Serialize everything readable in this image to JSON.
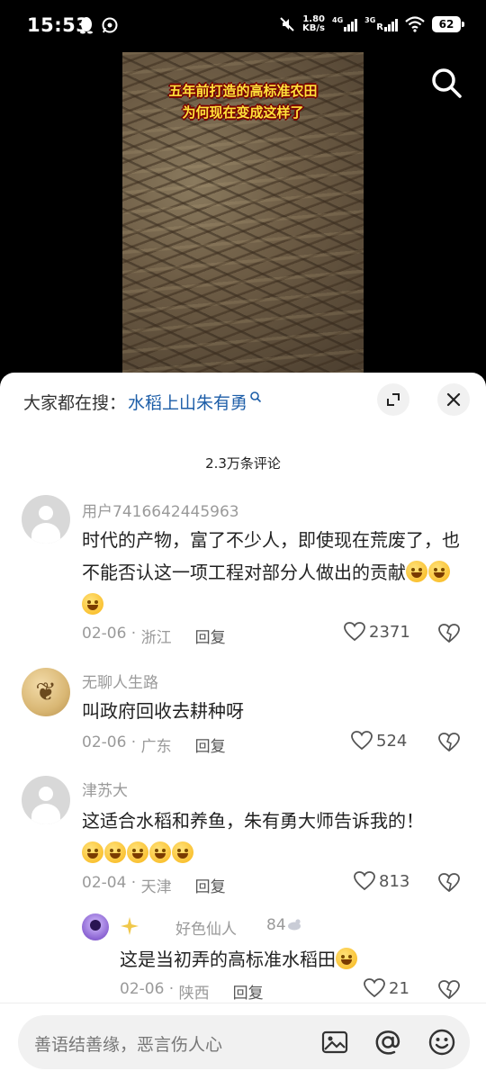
{
  "status_bar": {
    "time": "15:53",
    "net_speed_value": "1.80",
    "net_speed_unit": "KB/s",
    "sim1_label": "4G",
    "sim2_label": "3G",
    "sim2_roaming": "R",
    "battery": "62"
  },
  "video": {
    "caption_line1": "五年前打造的高标准农田",
    "caption_line2": "为何现在变成这样了"
  },
  "sheet": {
    "search_prefix": "大家都在搜：",
    "search_term": "水稻上山朱有勇",
    "comment_count": "2.3万条评论"
  },
  "comments": [
    {
      "user": "用户7416642445963",
      "text": "时代的产物，富了不少人，即使现在荒废了，也不能否认这一项工程对部分人做出的贡献",
      "emoji_count": 3,
      "date": "02-06",
      "location": "浙江",
      "reply_label": "回复",
      "likes": "2371"
    },
    {
      "user": "无聊人生路",
      "text": "叫政府回收去耕种呀",
      "date": "02-06",
      "location": "广东",
      "reply_label": "回复",
      "likes": "524"
    },
    {
      "user": "津苏大",
      "text": "这适合水稻和养鱼，朱有勇大师告诉我的！",
      "emoji_count": 5,
      "date": "02-04",
      "location": "天津",
      "reply_label": "回复",
      "likes": "813"
    }
  ],
  "reply": {
    "user": "好色仙人",
    "level": "84",
    "text": "这是当初弄的高标准水稻田",
    "date": "02-06",
    "location": "陕西",
    "reply_label": "回复",
    "likes": "21"
  },
  "input": {
    "placeholder": "善语结善缘，恶言伤人心"
  },
  "colors": {
    "link_blue": "#1d5ea8",
    "caption_yellow": "#ffe23a"
  }
}
